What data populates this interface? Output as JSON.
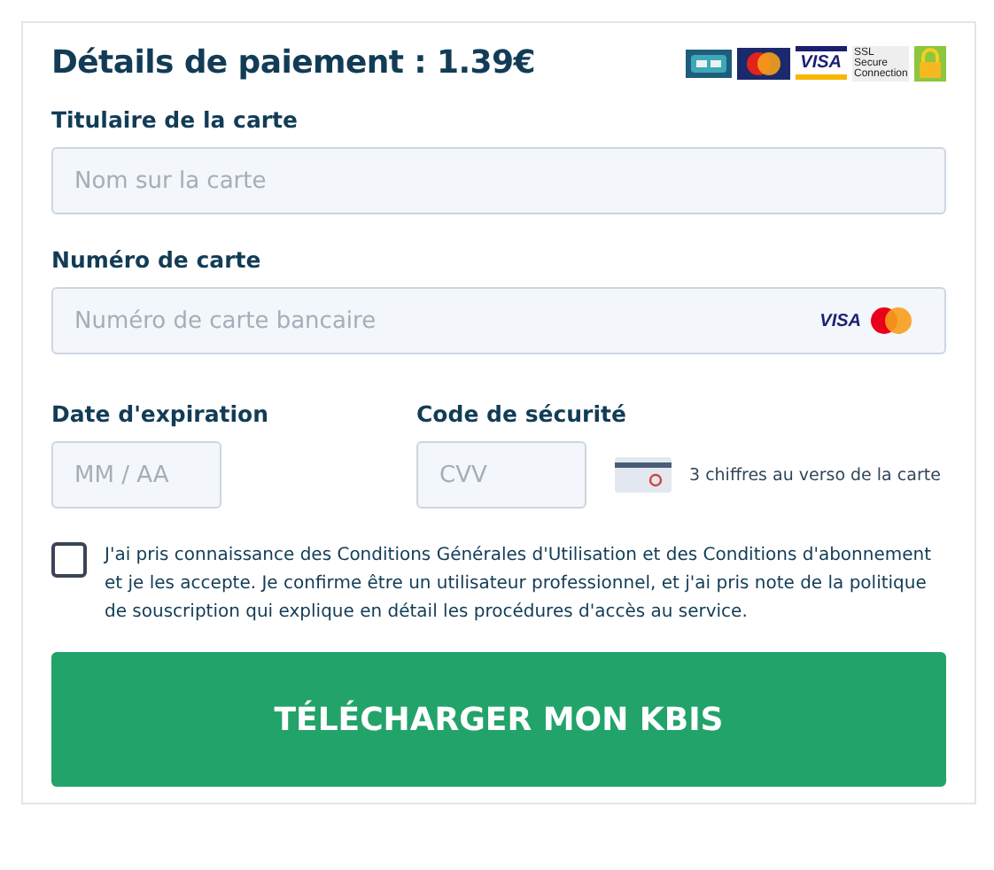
{
  "title": "Détails de paiement : 1.39€",
  "badges": [
    {
      "kind": "cb"
    },
    {
      "kind": "mastercard"
    },
    {
      "kind": "visa",
      "text": "VISA"
    },
    {
      "kind": "ssl",
      "text": "SSL Secure Connection"
    },
    {
      "kind": "lock"
    }
  ],
  "holder": {
    "label": "Titulaire de la carte",
    "placeholder": "Nom sur la carte"
  },
  "number": {
    "label": "Numéro de carte",
    "placeholder": "Numéro de carte bancaire",
    "brand_text": "VISA"
  },
  "expiry": {
    "label": "Date d'expiration",
    "placeholder": "MM / AA"
  },
  "cvv": {
    "label": "Code de sécurité",
    "placeholder": "CVV",
    "hint": "3 chiffres au verso de la carte"
  },
  "terms": {
    "checked": false,
    "text": "J'ai pris connaissance des Conditions Générales d'Utilisation et des Conditions d'abonnement et je les accepte. Je confirme être un utilisateur professionnel, et j'ai pris note de la politique de souscription qui explique en détail les procédures d'accès au service."
  },
  "submit": "TÉLÉCHARGER MON KBIS"
}
